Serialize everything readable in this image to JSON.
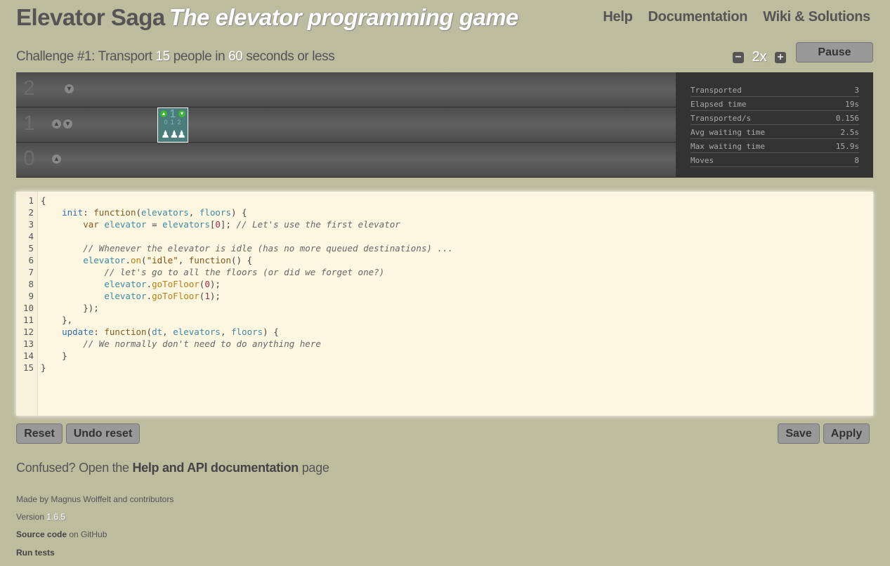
{
  "header": {
    "title": "Elevator Saga",
    "subtitle": "The elevator programming game",
    "nav": [
      "Help",
      "Documentation",
      "Wiki & Solutions"
    ]
  },
  "challenge": {
    "prefix": "Challenge #1: Transport",
    "people": "15",
    "middle": "people in",
    "seconds": "60",
    "suffix": "seconds or less"
  },
  "speed": {
    "minus": "−",
    "value": "2x",
    "plus": "+"
  },
  "pause_label": "Pause",
  "world": {
    "floors": [
      {
        "number": "2"
      },
      {
        "number": "1"
      },
      {
        "number": "0"
      }
    ],
    "elevator": {
      "floor_display": "1",
      "buttons": "0 1 2",
      "passengers": "♟ ♟♟"
    }
  },
  "stats": [
    {
      "label": "Transported",
      "value": "3"
    },
    {
      "label": "Elapsed time",
      "value": "19s"
    },
    {
      "label": "Transported/s",
      "value": "0.156"
    },
    {
      "label": "Avg waiting time",
      "value": "2.5s"
    },
    {
      "label": "Max waiting time",
      "value": "15.9s"
    },
    {
      "label": "Moves",
      "value": "8"
    }
  ],
  "code_lines": [
    "{",
    "    init: function(elevators, floors) {",
    "        var elevator = elevators[0]; // Let's use the first elevator",
    "",
    "        // Whenever the elevator is idle (has no more queued destinations) ...",
    "        elevator.on(\"idle\", function() {",
    "            // let's go to all the floors (or did we forget one?)",
    "            elevator.goToFloor(0);",
    "            elevator.goToFloor(1);",
    "        });",
    "    },",
    "    update: function(dt, elevators, floors) {",
    "        // We normally don't need to do anything here",
    "    }",
    "}"
  ],
  "buttons": {
    "reset": "Reset",
    "undo_reset": "Undo reset",
    "save": "Save",
    "apply": "Apply"
  },
  "help_line": {
    "prefix": "Confused? Open the",
    "link": "Help and API documentation",
    "suffix": "page"
  },
  "footer": {
    "made_by": "Made by Magnus Wolffelt and contributors",
    "version_label": "Version",
    "version": "1.6.5",
    "source_link": "Source code",
    "source_suffix": "on GitHub",
    "run_tests": "Run tests"
  }
}
